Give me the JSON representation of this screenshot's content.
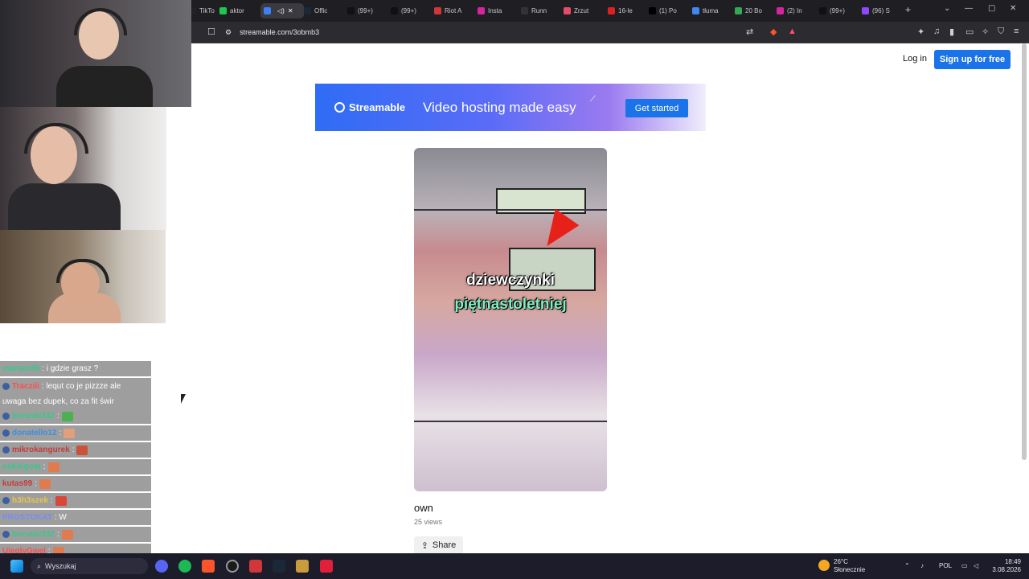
{
  "browser": {
    "tabs": [
      {
        "label": "TikTo",
        "color": "#222222"
      },
      {
        "label": "aktor",
        "color": "#1ec74f"
      },
      {
        "label": "",
        "color": "#3b82f6",
        "active": true
      },
      {
        "label": "Offic",
        "color": "#1b2838"
      },
      {
        "label": "(99+)",
        "color": "#111111"
      },
      {
        "label": "(99+)",
        "color": "#111111"
      },
      {
        "label": "Riot A",
        "color": "#d13639"
      },
      {
        "label": "Insta",
        "color": "#d6249f"
      },
      {
        "label": "Runn",
        "color": "#333333"
      },
      {
        "label": "Zrzut",
        "color": "#e84b6a"
      },
      {
        "label": "16-le",
        "color": "#e02020"
      },
      {
        "label": "(1) Po",
        "color": "#000000"
      },
      {
        "label": "tłuma",
        "color": "#4285f4"
      },
      {
        "label": "20 Bo",
        "color": "#34a853"
      },
      {
        "label": "(2) In",
        "color": "#d6249f"
      },
      {
        "label": "(99+)",
        "color": "#111111"
      },
      {
        "label": "(96) S",
        "color": "#9146ff"
      }
    ],
    "url": "streamable.com/3obmb3"
  },
  "page": {
    "login_label": "Log in",
    "signup_label": "Sign up for free",
    "banner": {
      "brand": "Streamable",
      "tagline": "Video hosting made easy",
      "cta": "Get started"
    },
    "video": {
      "caption_line1": "dziewczynki",
      "caption_line2": "piętnastoletniej",
      "title": "own",
      "views": "25 views",
      "share_label": "Share"
    }
  },
  "chat": [
    {
      "user": "mantex96",
      "color": "#36c98a",
      "badge": false,
      "message": ": i gdzie grasz ?"
    },
    {
      "user": "Tracziii",
      "color": "#ff4d4d",
      "badge": true,
      "message": ": lequt co je pizzze ale"
    },
    {
      "user": "",
      "color": "#ffffff",
      "badge": false,
      "message": "uwaga bez dupek, co za fit świr"
    },
    {
      "user": "boruski332",
      "color": "#36c98a",
      "badge": true,
      "message": ":"
    },
    {
      "user": "donatello12",
      "color": "#3a8ee6",
      "badge": true,
      "message": ":"
    },
    {
      "user": "mikrokangurek",
      "color": "#c43b3b",
      "badge": true,
      "message": ":"
    },
    {
      "user": "osk4rgoat",
      "color": "#36c98a",
      "badge": false,
      "message": ":"
    },
    {
      "user": "kutas99",
      "color": "#c43b3b",
      "badge": false,
      "message": ":"
    },
    {
      "user": "h3h3szek",
      "color": "#e8c64a",
      "badge": true,
      "message": ":"
    },
    {
      "user": "PROSTOKAT",
      "color": "#7a8cf0",
      "badge": false,
      "message": ": W"
    },
    {
      "user": "boruski332",
      "color": "#36c98a",
      "badge": true,
      "message": ":"
    },
    {
      "user": "UleglyGwel",
      "color": "#ff4d4d",
      "badge": false,
      "message": ":"
    }
  ],
  "taskbar": {
    "search_placeholder": "Wyszukaj",
    "weather_temp": "26°C",
    "weather_desc": "Słonecznie",
    "language": "POL",
    "time": "18:49",
    "date": "3.08.2026"
  }
}
